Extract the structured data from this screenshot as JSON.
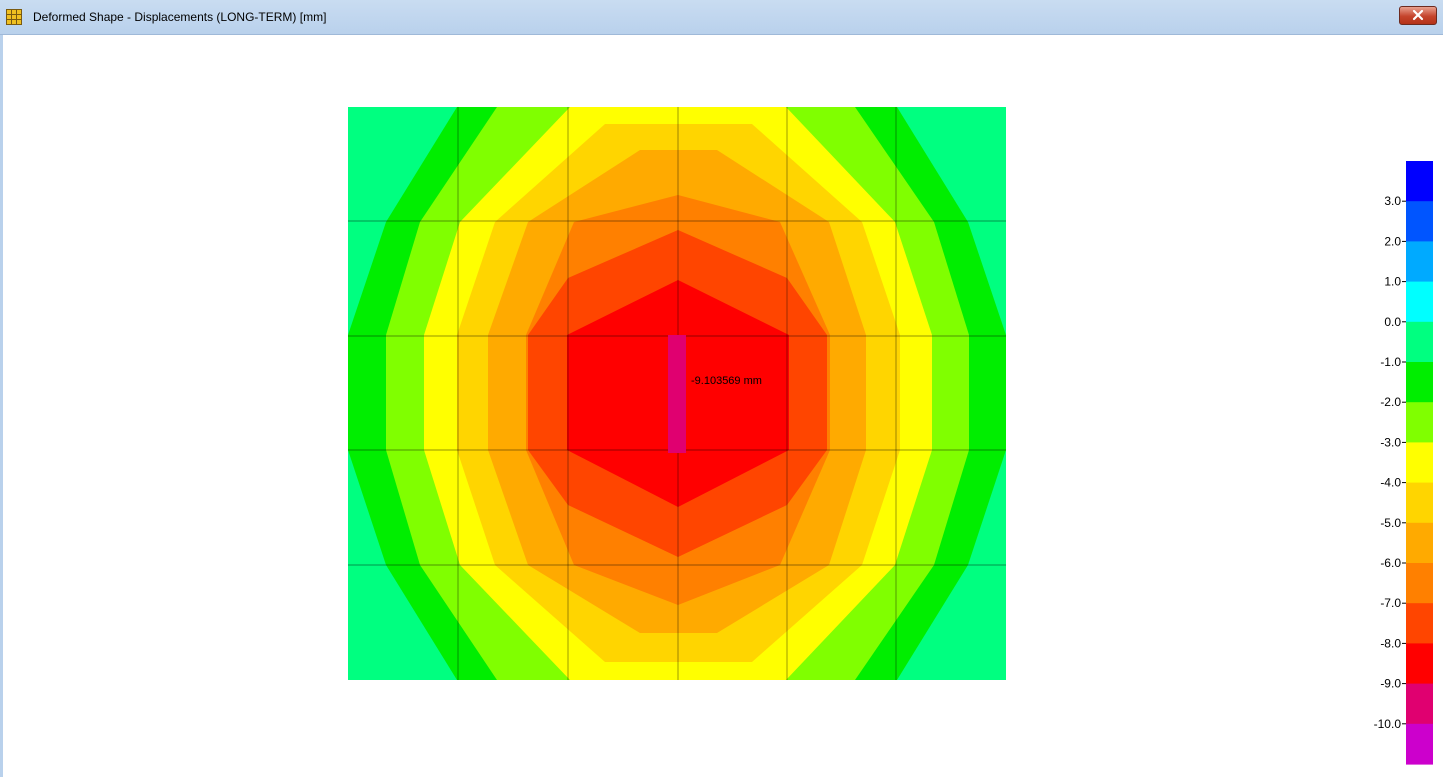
{
  "window": {
    "title": "Deformed Shape - Displacements (LONG-TERM)  [mm]",
    "app_icon": "grid-app-icon",
    "close_icon": "close-icon"
  },
  "result": {
    "max_displacement_label": "-9.103569 mm",
    "max_displacement_value": -9.103569,
    "units": "mm"
  },
  "contour": {
    "colors_by_level": {
      "-10": "#e00070",
      "-9": "#ff0000",
      "-8": "#ff4500",
      "-7": "#ff8000",
      "-6": "#ffaa00",
      "-5": "#ffd500",
      "-4": "#ffff00",
      "-3": "#80ff00",
      "-2": "#00ee00",
      "-1": "#00ff80"
    },
    "grid_color": "#000000"
  },
  "legend": {
    "labels": [
      "3.0",
      "2.0",
      "1.0",
      "0.0",
      "-1.0",
      "-2.0",
      "-3.0",
      "-4.0",
      "-5.0",
      "-6.0",
      "-7.0",
      "-8.0",
      "-9.0",
      "-10.0"
    ],
    "colors": [
      "#0000ff",
      "#0055ff",
      "#00aaff",
      "#00ffff",
      "#00ff80",
      "#00ee00",
      "#80ff00",
      "#ffff00",
      "#ffd500",
      "#ffaa00",
      "#ff8000",
      "#ff4500",
      "#ff0000",
      "#e00070",
      "#cc00cc"
    ]
  }
}
